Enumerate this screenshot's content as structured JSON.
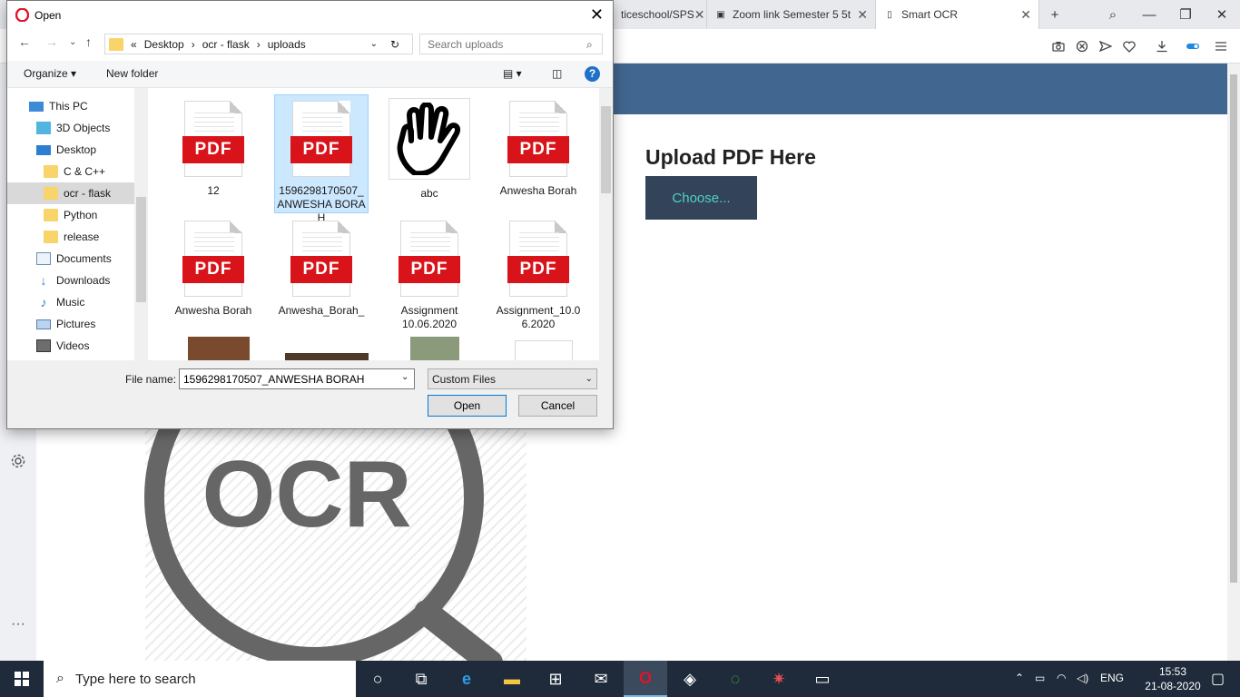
{
  "browser": {
    "tabs": [
      {
        "label": "ticeschool/SPS",
        "icon": "document-icon"
      },
      {
        "label": "Zoom link Semester 5 5t",
        "icon": "contact-card-icon"
      },
      {
        "label": "Smart OCR",
        "icon": "page-icon",
        "active": true
      }
    ],
    "new_tab": "+",
    "window_controls": {
      "minimize": "—",
      "maximize": "❐",
      "close": "✕"
    }
  },
  "page": {
    "upload_title": "Upload PDF Here",
    "choose_label": "Choose...",
    "logo_text": "OCR",
    "colors": {
      "header": "#41668f",
      "button_bg": "#33435a",
      "button_text": "#4fd1c5"
    }
  },
  "dialog": {
    "title": "Open",
    "breadcrumb": [
      "«",
      "Desktop",
      "›",
      "ocr - flask",
      "›",
      "uploads"
    ],
    "search_placeholder": "Search uploads",
    "organize_label": "Organize ▾",
    "new_folder_label": "New folder",
    "help_label": "?",
    "nav_items": [
      {
        "label": "This PC",
        "icon": "computer-icon"
      },
      {
        "label": "3D Objects",
        "icon": "cube-icon"
      },
      {
        "label": "Desktop",
        "icon": "desktop-icon"
      },
      {
        "label": "C & C++",
        "icon": "folder-icon"
      },
      {
        "label": "ocr - flask",
        "icon": "folder-icon",
        "selected": true
      },
      {
        "label": "Python",
        "icon": "folder-icon"
      },
      {
        "label": "release",
        "icon": "folder-icon"
      },
      {
        "label": "Documents",
        "icon": "documents-icon"
      },
      {
        "label": "Downloads",
        "icon": "download-icon"
      },
      {
        "label": "Music",
        "icon": "music-icon"
      },
      {
        "label": "Pictures",
        "icon": "pictures-icon"
      },
      {
        "label": "Videos",
        "icon": "videos-icon"
      }
    ],
    "files": [
      {
        "name": "12",
        "type": "pdf"
      },
      {
        "name": "1596298170507_ANWESHA BORAH",
        "type": "pdf",
        "selected": true
      },
      {
        "name": "abc",
        "type": "image"
      },
      {
        "name": "Anwesha Borah",
        "type": "pdf"
      },
      {
        "name": "Anwesha Borah",
        "type": "pdf"
      },
      {
        "name": "Anwesha_Borah_",
        "type": "pdf"
      },
      {
        "name": "Assignment 10.06.2020",
        "type": "pdf"
      },
      {
        "name": "Assignment_10.06.2020",
        "type": "pdf"
      }
    ],
    "pdf_badge": "PDF",
    "file_name_label": "File name:",
    "file_name_value": "1596298170507_ANWESHA BORAH",
    "file_type": "Custom Files",
    "open_label": "Open",
    "cancel_label": "Cancel"
  },
  "taskbar": {
    "search_placeholder": "Type here to search",
    "language": "ENG",
    "time": "15:53",
    "date": "21-08-2020"
  }
}
